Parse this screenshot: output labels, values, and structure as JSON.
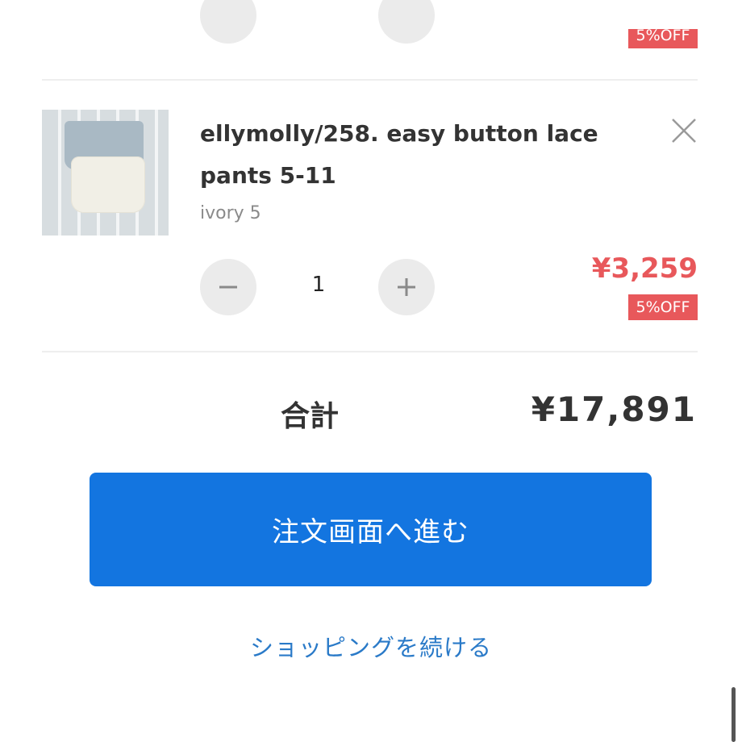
{
  "previous_item": {
    "discount_badge": "5%OFF"
  },
  "item": {
    "title": "ellymolly/258. easy button lace pants 5-11",
    "variant": "ivory 5",
    "quantity": "1",
    "price": "¥3,259",
    "discount_badge": "5%OFF"
  },
  "summary": {
    "total_label": "合計",
    "total_value": "¥17,891"
  },
  "actions": {
    "checkout_label": "注文画面へ進む",
    "continue_label": "ショッピングを続ける"
  },
  "colors": {
    "accent_blue": "#1375e0",
    "link_blue": "#2a7ac8",
    "price_red": "#e8585b"
  }
}
